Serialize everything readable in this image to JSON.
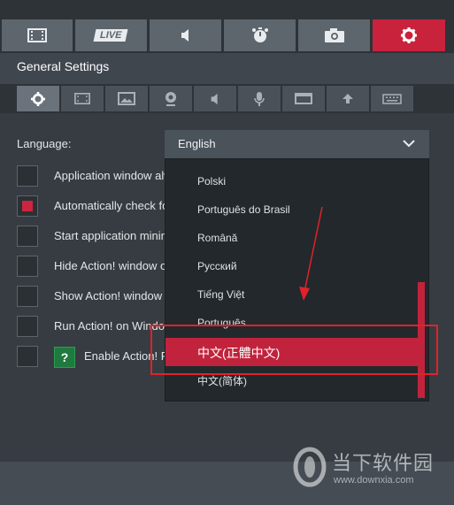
{
  "top_tabs": [
    {
      "id": "video",
      "icon": "film-icon"
    },
    {
      "id": "live",
      "icon": "live-badge-icon",
      "label": "LIVE"
    },
    {
      "id": "audio",
      "icon": "speaker-icon"
    },
    {
      "id": "benchmark",
      "icon": "stopwatch-icon"
    },
    {
      "id": "screenshot",
      "icon": "camera-icon"
    },
    {
      "id": "settings",
      "icon": "gear-icon",
      "active": true
    }
  ],
  "settings": {
    "title": "General Settings",
    "sub_tabs": [
      "gear-icon",
      "film-icon",
      "image-icon",
      "webcam-icon",
      "speaker-icon",
      "microphone-icon",
      "window-icon",
      "upload-arrow-icon",
      "keyboard-icon"
    ],
    "language_label": "Language:",
    "language_value": "English",
    "options": [
      {
        "label": "Application window alw",
        "checked": false
      },
      {
        "label": "Automatically check fo",
        "checked": true
      },
      {
        "label": "Start application minim",
        "checked": false
      },
      {
        "label": "Hide Action! window or",
        "checked": false
      },
      {
        "label": "Show Action! window w",
        "checked": false
      },
      {
        "label": "Run Action! on Window",
        "checked": false
      },
      {
        "label": "Enable Action! RC",
        "checked": false,
        "help": "?"
      }
    ]
  },
  "language_list": {
    "items": [
      "Polski",
      "Português do Brasil",
      "Română",
      "Русский",
      "Tiếng Việt",
      "Português",
      "中文(正體中文)",
      "中文(简体)"
    ],
    "selected_index": 6
  },
  "watermark": {
    "brand": "当下软件园",
    "url": "www.downxia.com"
  },
  "colors": {
    "accent": "#c9223c",
    "annotation": "#e0222a"
  }
}
